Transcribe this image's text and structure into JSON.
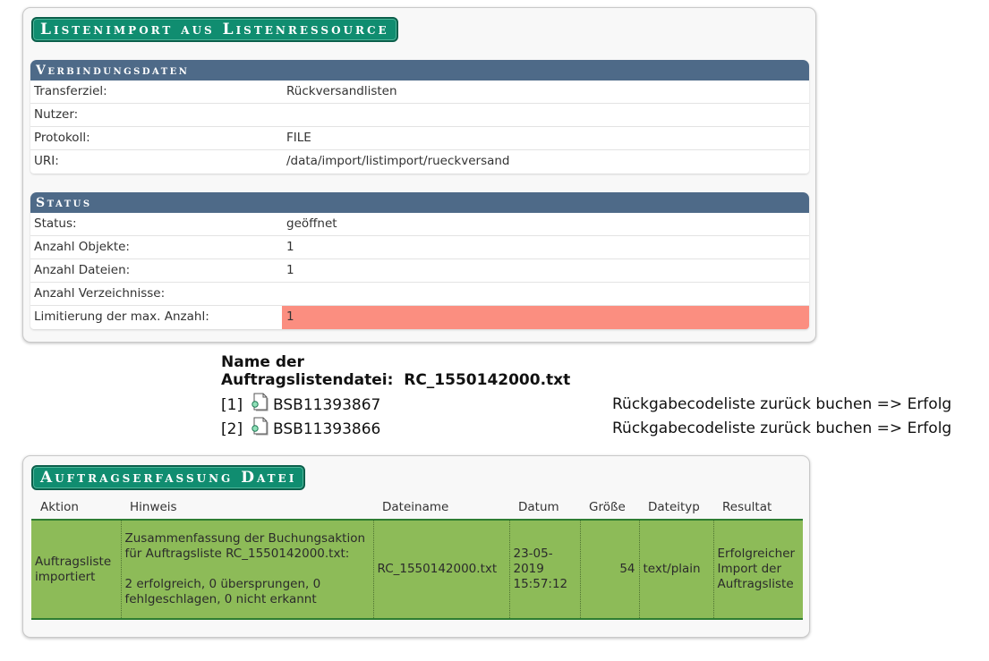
{
  "import_panel": {
    "title": "Listenimport aus Listenressource",
    "connection": {
      "heading": "Verbindungsdaten",
      "rows": [
        {
          "label": "Transferziel:",
          "value": "Rückversandlisten"
        },
        {
          "label": "Nutzer:",
          "value": ""
        },
        {
          "label": "Protokoll:",
          "value": "FILE"
        },
        {
          "label": "URI:",
          "value": "/data/import/listimport/rueckversand"
        }
      ]
    },
    "status": {
      "heading": "Status",
      "rows": [
        {
          "label": "Status:",
          "value": "geöffnet"
        },
        {
          "label": "Anzahl Objekte:",
          "value": "1"
        },
        {
          "label": "Anzahl Dateien:",
          "value": "1"
        },
        {
          "label": "Anzahl Verzeichnisse:",
          "value": ""
        },
        {
          "label": "Limitierung der max. Anzahl:",
          "value": "1"
        }
      ],
      "warning_color": "#fb8e80"
    }
  },
  "file_list": {
    "label_line1": "Name der",
    "label_line2": "Auftragslistendatei:",
    "file_name": "RC_1550142000.txt",
    "entries": [
      {
        "index": "[1]",
        "name": "BSB11393867",
        "result": "Rückgabecodeliste zurück buchen => Erfolg"
      },
      {
        "index": "[2]",
        "name": "BSB11393866",
        "result": "Rückgabecodeliste zurück buchen => Erfolg"
      }
    ]
  },
  "order_panel": {
    "title": "Auftragserfassung Datei",
    "columns": [
      "Aktion",
      "Hinweis",
      "Dateiname",
      "Datum",
      "Größe",
      "Dateityp",
      "Resultat"
    ],
    "row": {
      "aktion": "Auftragsliste importiert",
      "hinweis_line1": "Zusammenfassung der Buchungsaktion für Auftragsliste RC_1550142000.txt:",
      "hinweis_line2": "2 erfolgreich, 0 übersprungen, 0 fehlgeschlagen, 0 nicht erkannt",
      "dateiname": "RC_1550142000.txt",
      "datum": "23-05-2019 15:57:12",
      "groesse": "54",
      "dateityp": "text/plain",
      "resultat": "Erfolgreicher Import der Auftragsliste"
    },
    "success_color": "#8dbb58"
  },
  "colors": {
    "title_badge": "#108d70",
    "section_header": "#4e6a88"
  },
  "icons": {
    "file_entry": "document-icon"
  }
}
